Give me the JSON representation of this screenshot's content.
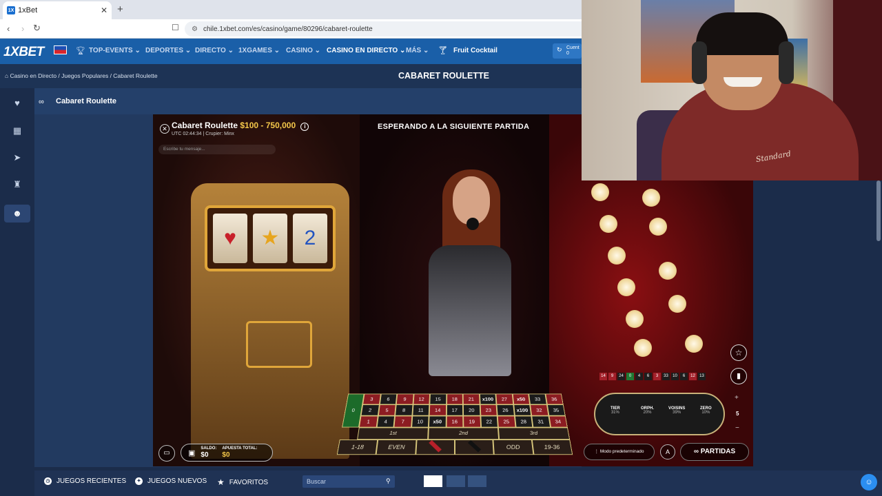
{
  "browser": {
    "tab_title": "1xBet",
    "favicon_text": "1X",
    "url": "chile.1xbet.com/es/casino/game/80296/cabaret-roulette"
  },
  "header": {
    "logo": "1XBET",
    "nav": [
      {
        "label": "TOP-EVENTS ⌄"
      },
      {
        "label": "DEPORTES ⌄"
      },
      {
        "label": "DIRECTO ⌄"
      },
      {
        "label": "1XGAMES ⌄"
      },
      {
        "label": "CASINO ⌄"
      },
      {
        "label": "CASINO EN DIRECTO ⌄"
      },
      {
        "label": "MÁS ⌄"
      },
      {
        "label": "Fruit Cocktail"
      }
    ],
    "account_label": "Cuent",
    "account_value": "0"
  },
  "breadcrumb": "Casino en Directo / Juegos Populares / Cabaret Roulette",
  "page_title": "CABARET ROULETTE",
  "game_panel_title": "Cabaret Roulette",
  "game": {
    "name": "Cabaret Roulette",
    "limits": "$100 - 750,000",
    "meta": "UTC 02:44:34 | Crupier: Minx",
    "chat_placeholder": "Escribe tu mensaje...",
    "status": "ESPERANDO A LA SIGUIENTE PARTIDA",
    "table": {
      "zero": "0",
      "rows": [
        [
          {
            "v": "3",
            "c": "r"
          },
          {
            "v": "6",
            "c": "b"
          },
          {
            "v": "9",
            "c": "r"
          },
          {
            "v": "12",
            "c": "r"
          },
          {
            "v": "15",
            "c": "b"
          },
          {
            "v": "18",
            "c": "r"
          },
          {
            "v": "21",
            "c": "r"
          },
          {
            "v": "x100",
            "c": "b"
          },
          {
            "v": "27",
            "c": "r"
          },
          {
            "v": "x50",
            "c": "r"
          },
          {
            "v": "33",
            "c": "b"
          },
          {
            "v": "36",
            "c": "r"
          }
        ],
        [
          {
            "v": "2",
            "c": "b"
          },
          {
            "v": "5",
            "c": "r"
          },
          {
            "v": "8",
            "c": "b"
          },
          {
            "v": "11",
            "c": "b"
          },
          {
            "v": "14",
            "c": "r"
          },
          {
            "v": "17",
            "c": "b"
          },
          {
            "v": "20",
            "c": "b"
          },
          {
            "v": "23",
            "c": "r"
          },
          {
            "v": "26",
            "c": "b"
          },
          {
            "v": "x100",
            "c": "b"
          },
          {
            "v": "32",
            "c": "r"
          },
          {
            "v": "35",
            "c": "b"
          }
        ],
        [
          {
            "v": "1",
            "c": "r"
          },
          {
            "v": "4",
            "c": "b"
          },
          {
            "v": "7",
            "c": "r"
          },
          {
            "v": "10",
            "c": "b"
          },
          {
            "v": "x50",
            "c": "b"
          },
          {
            "v": "16",
            "c": "r"
          },
          {
            "v": "19",
            "c": "r"
          },
          {
            "v": "22",
            "c": "b"
          },
          {
            "v": "25",
            "c": "r"
          },
          {
            "v": "28",
            "c": "b"
          },
          {
            "v": "31",
            "c": "b"
          },
          {
            "v": "34",
            "c": "r"
          }
        ]
      ],
      "dozens": [
        "1st",
        "2nd",
        "3rd"
      ],
      "outside": [
        "1-18",
        "EVEN",
        "",
        "",
        "ODD",
        "19-36"
      ]
    },
    "history": [
      {
        "v": "14",
        "c": "r"
      },
      {
        "v": "9",
        "c": "r"
      },
      {
        "v": "24",
        "c": "b"
      },
      {
        "v": "0",
        "c": "g"
      },
      {
        "v": "4",
        "c": "b"
      },
      {
        "v": "6",
        "c": "b"
      },
      {
        "v": "3",
        "c": "r"
      },
      {
        "v": "33",
        "c": "b"
      },
      {
        "v": "10",
        "c": "b"
      },
      {
        "v": "6",
        "c": "b"
      },
      {
        "v": "12",
        "c": "r"
      },
      {
        "v": "13",
        "c": "b"
      }
    ],
    "racetrack": [
      {
        "name": "TIER",
        "pct": "31%"
      },
      {
        "name": "ORPH.",
        "pct": "20%"
      },
      {
        "name": "VOISINS",
        "pct": "39%"
      },
      {
        "name": "ZERO",
        "pct": "10%"
      }
    ],
    "zoom_value": "5",
    "balance_label": "SALDO:",
    "balance_value": "$0",
    "total_bet_label": "APUESTA TOTAL:",
    "total_bet_value": "$0",
    "mode_label": "⋮ Modo predeterminado",
    "auto_label": "A",
    "partidas_label": "PARTIDAS"
  },
  "bottom_bar": {
    "recent": "JUEGOS RECIENTES",
    "new": "JUEGOS NUEVOS",
    "favorites": "FAVORITOS",
    "search_placeholder": "Buscar"
  },
  "webcam": {
    "shirt_text": "Standard"
  },
  "colors": {
    "brand_blue": "#1a5fa8",
    "limits_gold": "#f5c84a",
    "table_red": "#8c1c22",
    "table_green": "#1c6b2a"
  }
}
